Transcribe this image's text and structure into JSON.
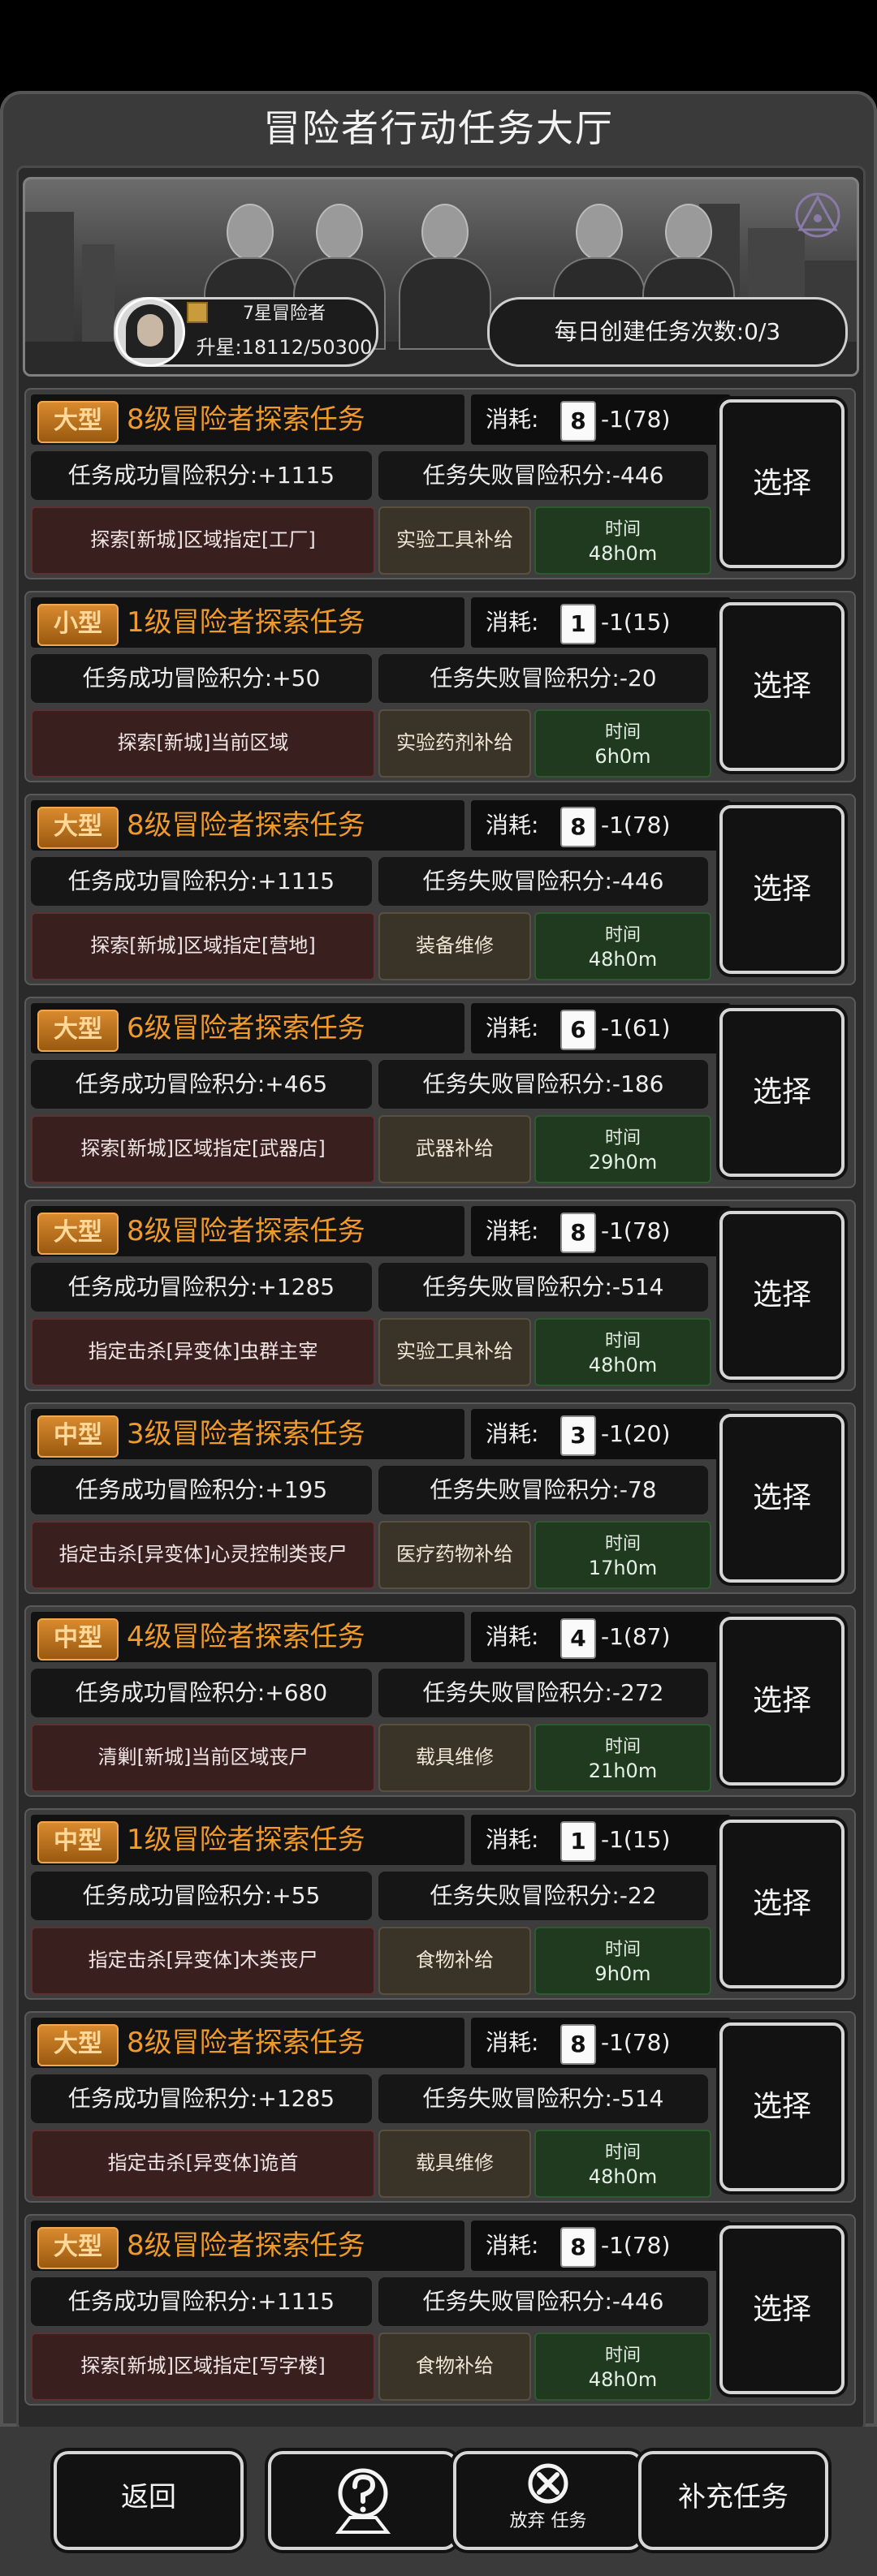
{
  "header": {
    "title": "冒险者行动任务大厅"
  },
  "banner": {
    "rank_name": "7星冒险者",
    "rank_xp": "升星:18112/50300",
    "daily": "每日创建任务次数:0/3"
  },
  "labels": {
    "cost": "消耗:",
    "time": "时间",
    "select": "选择"
  },
  "tasks": [
    {
      "size": "大型",
      "name": "8级冒险者探索任务",
      "card": "8",
      "cost": "-1(78)",
      "success": "任务成功冒险积分:+1115",
      "fail": "任务失败冒险积分:-446",
      "target": "探索[新城]区域指定[工厂]",
      "reward": "实验工具补给",
      "time": "48h0m"
    },
    {
      "size": "小型",
      "name": "1级冒险者探索任务",
      "card": "1",
      "cost": "-1(15)",
      "success": "任务成功冒险积分:+50",
      "fail": "任务失败冒险积分:-20",
      "target": "探索[新城]当前区域",
      "reward": "实验药剂补给",
      "time": "6h0m"
    },
    {
      "size": "大型",
      "name": "8级冒险者探索任务",
      "card": "8",
      "cost": "-1(78)",
      "success": "任务成功冒险积分:+1115",
      "fail": "任务失败冒险积分:-446",
      "target": "探索[新城]区域指定[营地]",
      "reward": "装备维修",
      "time": "48h0m"
    },
    {
      "size": "大型",
      "name": "6级冒险者探索任务",
      "card": "6",
      "cost": "-1(61)",
      "success": "任务成功冒险积分:+465",
      "fail": "任务失败冒险积分:-186",
      "target": "探索[新城]区域指定[武器店]",
      "reward": "武器补给",
      "time": "29h0m"
    },
    {
      "size": "大型",
      "name": "8级冒险者探索任务",
      "card": "8",
      "cost": "-1(78)",
      "success": "任务成功冒险积分:+1285",
      "fail": "任务失败冒险积分:-514",
      "target": "指定击杀[异变体]虫群主宰",
      "reward": "实验工具补给",
      "time": "48h0m"
    },
    {
      "size": "中型",
      "name": "3级冒险者探索任务",
      "card": "3",
      "cost": "-1(20)",
      "success": "任务成功冒险积分:+195",
      "fail": "任务失败冒险积分:-78",
      "target": "指定击杀[异变体]心灵控制类丧尸",
      "reward": "医疗药物补给",
      "time": "17h0m"
    },
    {
      "size": "中型",
      "name": "4级冒险者探索任务",
      "card": "4",
      "cost": "-1(87)",
      "success": "任务成功冒险积分:+680",
      "fail": "任务失败冒险积分:-272",
      "target": "清剿[新城]当前区域丧尸",
      "reward": "载具维修",
      "time": "21h0m"
    },
    {
      "size": "中型",
      "name": "1级冒险者探索任务",
      "card": "1",
      "cost": "-1(15)",
      "success": "任务成功冒险积分:+55",
      "fail": "任务失败冒险积分:-22",
      "target": "指定击杀[异变体]木类丧尸",
      "reward": "食物补给",
      "time": "9h0m"
    },
    {
      "size": "大型",
      "name": "8级冒险者探索任务",
      "card": "8",
      "cost": "-1(78)",
      "success": "任务成功冒险积分:+1285",
      "fail": "任务失败冒险积分:-514",
      "target": "指定击杀[异变体]诡首",
      "reward": "载具维修",
      "time": "48h0m"
    },
    {
      "size": "大型",
      "name": "8级冒险者探索任务",
      "card": "8",
      "cost": "-1(78)",
      "success": "任务成功冒险积分:+1115",
      "fail": "任务失败冒险积分:-446",
      "target": "探索[新城]区域指定[写字楼]",
      "reward": "食物补给",
      "time": "48h0m"
    }
  ],
  "bottom": {
    "back": "返回",
    "help_icon": "question-icon",
    "abandon": "放弃 任务",
    "abandon_icon": "close-icon",
    "refill": "补充任务"
  }
}
